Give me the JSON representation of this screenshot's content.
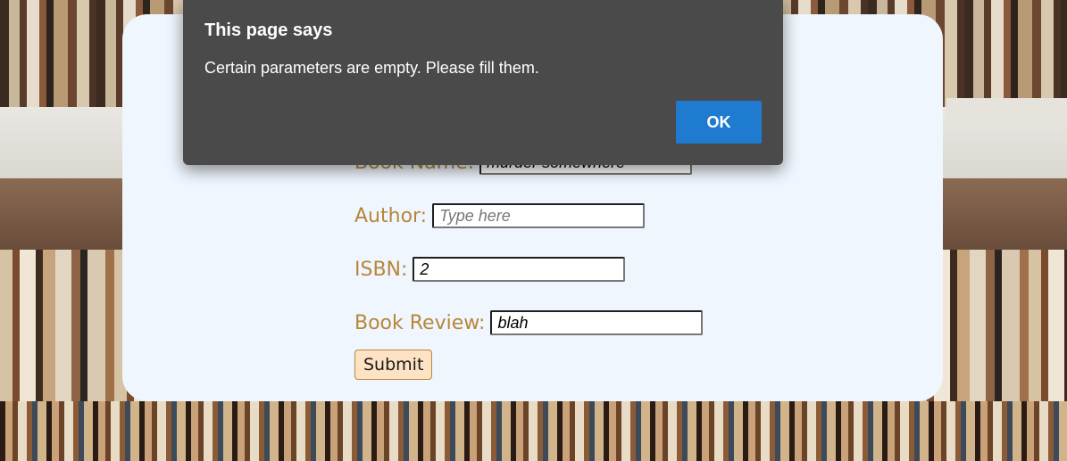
{
  "dialog": {
    "title": "This page says",
    "message": "Certain parameters are empty. Please fill them.",
    "ok_label": "OK"
  },
  "form": {
    "book_name": {
      "label": "Book Name:",
      "value": "murder somewhere"
    },
    "author": {
      "label": "Author:",
      "value": "",
      "placeholder": "Type here"
    },
    "isbn": {
      "label": "ISBN:",
      "value": "2"
    },
    "book_review": {
      "label": "Book Review:",
      "value": "blah"
    },
    "submit_label": "Submit"
  },
  "colors": {
    "label": "#b8863b",
    "card_bg": "#eff6fd",
    "dialog_bg": "#4a4a4a",
    "ok_button": "#1f7bcf",
    "submit_bg": "#fde3c3"
  }
}
